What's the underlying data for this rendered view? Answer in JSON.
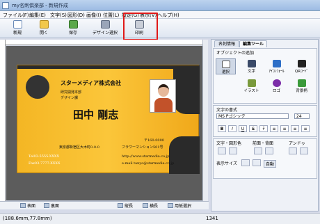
{
  "window": {
    "title": "my名刺倶楽部 - 新規作成"
  },
  "menu": {
    "items": [
      "ファイル(F)",
      "編集(E)",
      "文字(S)",
      "図形(D)",
      "画像(I)",
      "位置(L)",
      "設定(G)",
      "表示(V)",
      "ヘルプ(H)"
    ]
  },
  "toolbar": {
    "new": "新規",
    "open": "開く",
    "save": "保存",
    "design": "デザイン選択",
    "print": "印刷"
  },
  "card": {
    "company": "スターメディア株式会社",
    "dept": "研究開発本部",
    "role": "デザイン課",
    "name": "田中 剛志",
    "zip": "〒160-0000",
    "addr1": "東京都新宿区大木町0-0-0",
    "addr2": "フラワーマンション501号",
    "tel": "Tel03-5555-XXXX",
    "fax": "Fax03-7777-XXXX",
    "url": "http://www.starmedia.co.jp",
    "email": "e-mail tanyo@starmedia.co.jp"
  },
  "bottom": {
    "front": "表面",
    "back": "裏面",
    "portrait": "縦長",
    "landscape": "横長",
    "paper": "用紙選択"
  },
  "status": {
    "coords": "(188.6mm,77.8mm)",
    "count": "1341"
  },
  "panel": {
    "tabs": [
      "名刺情報",
      "編集ツール"
    ],
    "add_title": "オブジェクトの追加",
    "objects": [
      "選択",
      "文字",
      "ｱｲｺﾝﾌｫｰﾙ",
      "QRｺｰﾄﾞ",
      "イラスト",
      "ロゴ",
      "背景柄"
    ],
    "format_title": "文字の書式",
    "font": "MS Pゴシック",
    "size": "24",
    "format_buttons": [
      "B",
      "I",
      "U",
      "S",
      "ﾁ",
      "≡",
      "≡",
      "≡",
      "≡"
    ],
    "color_title": "文字・図形色",
    "order_title": "前面・背面",
    "undo_title": "アンドゥ",
    "zoom_title": "表示サイズ",
    "zoom_auto": "自動"
  }
}
